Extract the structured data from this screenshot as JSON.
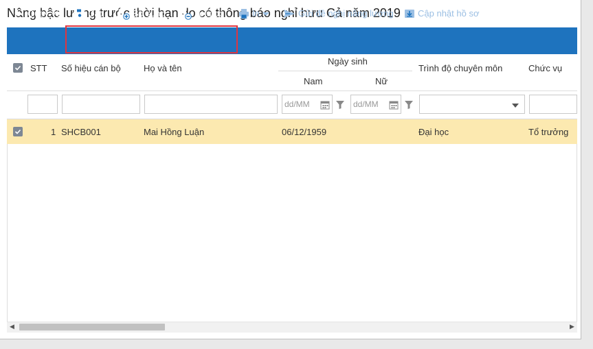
{
  "page": {
    "title": "Nâng bậc lương trước thời hạn do có thông báo nghỉ hưu Cả năm 2019"
  },
  "toolbar": {
    "back": "Quay về",
    "save": "Cất",
    "add": "Bổ sung",
    "remove": "Loại bỏ",
    "print": "In",
    "send": "Gửi đề nghị nâng lương",
    "update": "Cập nhật hồ sơ",
    "reload": "Nạp"
  },
  "table": {
    "columns": {
      "stt": "STT",
      "code": "Số hiệu cán bộ",
      "name": "Họ và tên",
      "dob": "Ngày sinh",
      "male": "Nam",
      "female": "Nữ",
      "education": "Trình độ chuyên môn",
      "position": "Chức vụ"
    },
    "filters": {
      "date_placeholder": "dd/MM"
    },
    "rows": [
      {
        "stt": "1",
        "code": "SHCB001",
        "name": "Mai Hồng Luận",
        "dob_male": "06/12/1959",
        "dob_female": "",
        "education": "Đại học",
        "position": "Tổ trưởng"
      }
    ]
  },
  "colors": {
    "toolbar": "#1e73be",
    "selected_row": "#fce9b0",
    "highlight": "#e0353f"
  }
}
